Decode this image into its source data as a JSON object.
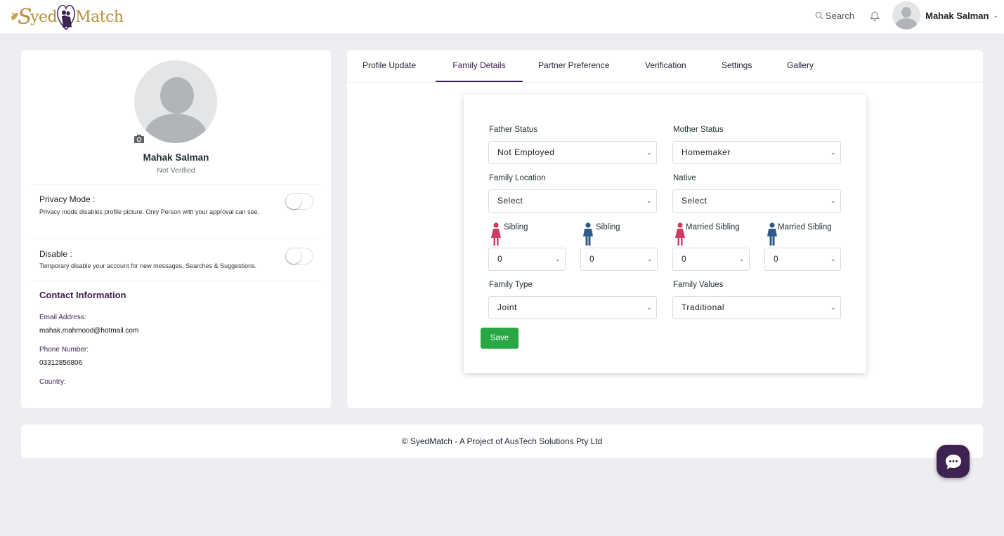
{
  "header": {
    "brand": "SyedMatch",
    "brand_first": "yed",
    "brand_second": "Match",
    "search_label": "Search",
    "user_name": "Mahak Salman"
  },
  "profile": {
    "name": "Mahak Salman",
    "status": "Not Verified",
    "privacy": {
      "title": "Privacy Mode :",
      "description": "Privacy mode disables profile picture. Only Person with your approval can see.",
      "enabled": false
    },
    "disable": {
      "title": "Disable :",
      "description": "Temporary disable your account for new messages, Searches & Suggestions.",
      "enabled": false
    },
    "contact": {
      "title": "Contact Information",
      "email_label": "Email Address:",
      "email": "mahak.mahmood@hotmail.com",
      "phone_label": "Phone Number:",
      "phone": "03312856806",
      "country_label": "Country:",
      "country": ""
    }
  },
  "tabs": [
    {
      "label": "Profile Update",
      "active": false
    },
    {
      "label": "Family Details",
      "active": true
    },
    {
      "label": "Partner Preference",
      "active": false
    },
    {
      "label": "Verification",
      "active": false
    },
    {
      "label": "Settings",
      "active": false
    },
    {
      "label": "Gallery",
      "active": false
    }
  ],
  "form": {
    "father_status": {
      "label": "Father Status",
      "value": "Not Employed"
    },
    "mother_status": {
      "label": "Mother Status",
      "value": "Homemaker"
    },
    "family_location": {
      "label": "Family Location",
      "value": "Select"
    },
    "native": {
      "label": "Native",
      "value": "Select"
    },
    "siblings": [
      {
        "label": "Sibling",
        "gender": "female",
        "value": "0"
      },
      {
        "label": "Sibling",
        "gender": "male",
        "value": "0"
      },
      {
        "label": "Married Sibling",
        "gender": "female",
        "value": "0"
      },
      {
        "label": "Married Sibling",
        "gender": "male",
        "value": "0"
      }
    ],
    "family_type": {
      "label": "Family Type",
      "value": "Joint"
    },
    "family_values": {
      "label": "Family Values",
      "value": "Traditional"
    },
    "save_label": "Save"
  },
  "colors": {
    "female": "#d03a64",
    "male": "#2f5c86",
    "accent": "#3b2350",
    "save": "#28a745"
  },
  "footer": {
    "text": "© SyedMatch - A Project of AusTech Solutions Pty Ltd"
  }
}
